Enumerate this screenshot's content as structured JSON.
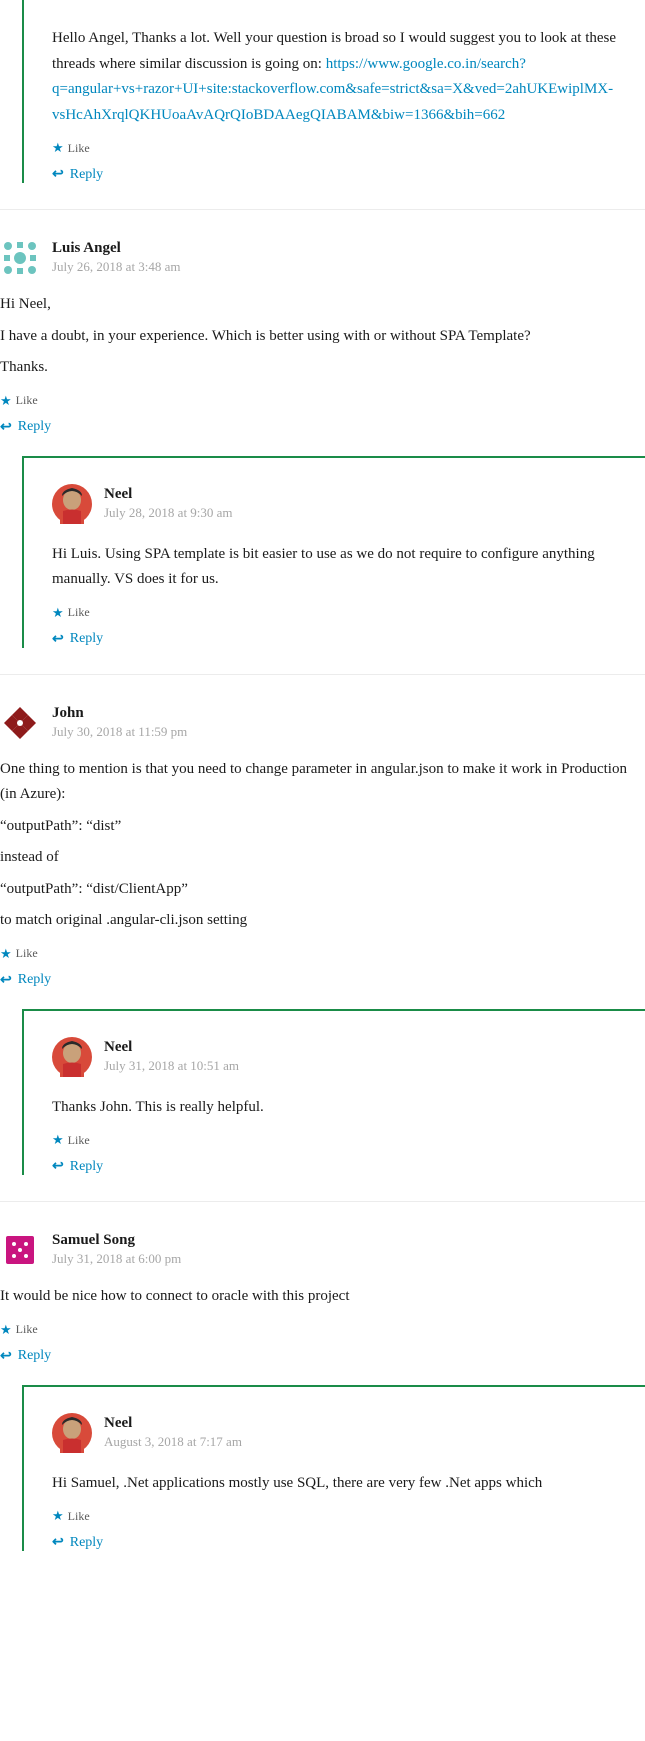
{
  "ui": {
    "like_label": "Like",
    "reply_label": "Reply"
  },
  "comments": [
    {
      "level": 2,
      "first": true,
      "author": null,
      "timestamp": null,
      "avatar": null,
      "body_html": "Hello Angel, Thanks a lot. Well your question is broad so I would suggest you to look at these threads where similar discussion is going on: <a href='#' data-name='comment-link' data-interactable='true'>https://www.google.co.in/search?q=angular+vs+razor+UI+site:stackoverflow.com&safe=strict&sa=X&ved=2ahUKEwiplMX-vsHcAhXrqlQKHUoaAvAQrQIoBDAAegQIABAM&biw=1366&bih=662</a>"
    },
    {
      "level": 1,
      "author": "Luis Angel",
      "timestamp": "July 26, 2018 at 3:48 am",
      "avatar": "identicon-teal",
      "body_html": "<p>Hi Neel,</p><p>I have a doubt, in your experience. Which is better using with or without SPA Template?</p><p>Thanks.</p>"
    },
    {
      "level": 2,
      "author": "Neel",
      "timestamp": "July 28, 2018 at 9:30 am",
      "avatar": "neel",
      "body_html": "Hi Luis. Using SPA template is bit easier to use as we do not require to configure anything manually. VS does it for us."
    },
    {
      "level": 1,
      "author": "John",
      "timestamp": "July 30, 2018 at 11:59 pm",
      "avatar": "identicon-red",
      "body_html": "<p>One thing to mention is that you need to change parameter in angular.json to make it work in Production (in Azure):</p><p>“outputPath”: “dist”</p><p>instead of</p><p>“outputPath”: “dist/ClientApp”</p><p>to match original .angular-cli.json setting</p>"
    },
    {
      "level": 2,
      "author": "Neel",
      "timestamp": "July 31, 2018 at 10:51 am",
      "avatar": "neel",
      "body_html": "Thanks John. This is really helpful."
    },
    {
      "level": 1,
      "author": "Samuel Song",
      "timestamp": "July 31, 2018 at 6:00 pm",
      "avatar": "identicon-pink",
      "body_html": "<p>It would be nice how to connect to oracle with this project</p>"
    },
    {
      "level": 2,
      "author": "Neel",
      "timestamp": "August 3, 2018 at 7:17 am",
      "avatar": "neel",
      "body_html": "Hi Samuel, .Net applications mostly use SQL, there are very few .Net apps which"
    }
  ]
}
